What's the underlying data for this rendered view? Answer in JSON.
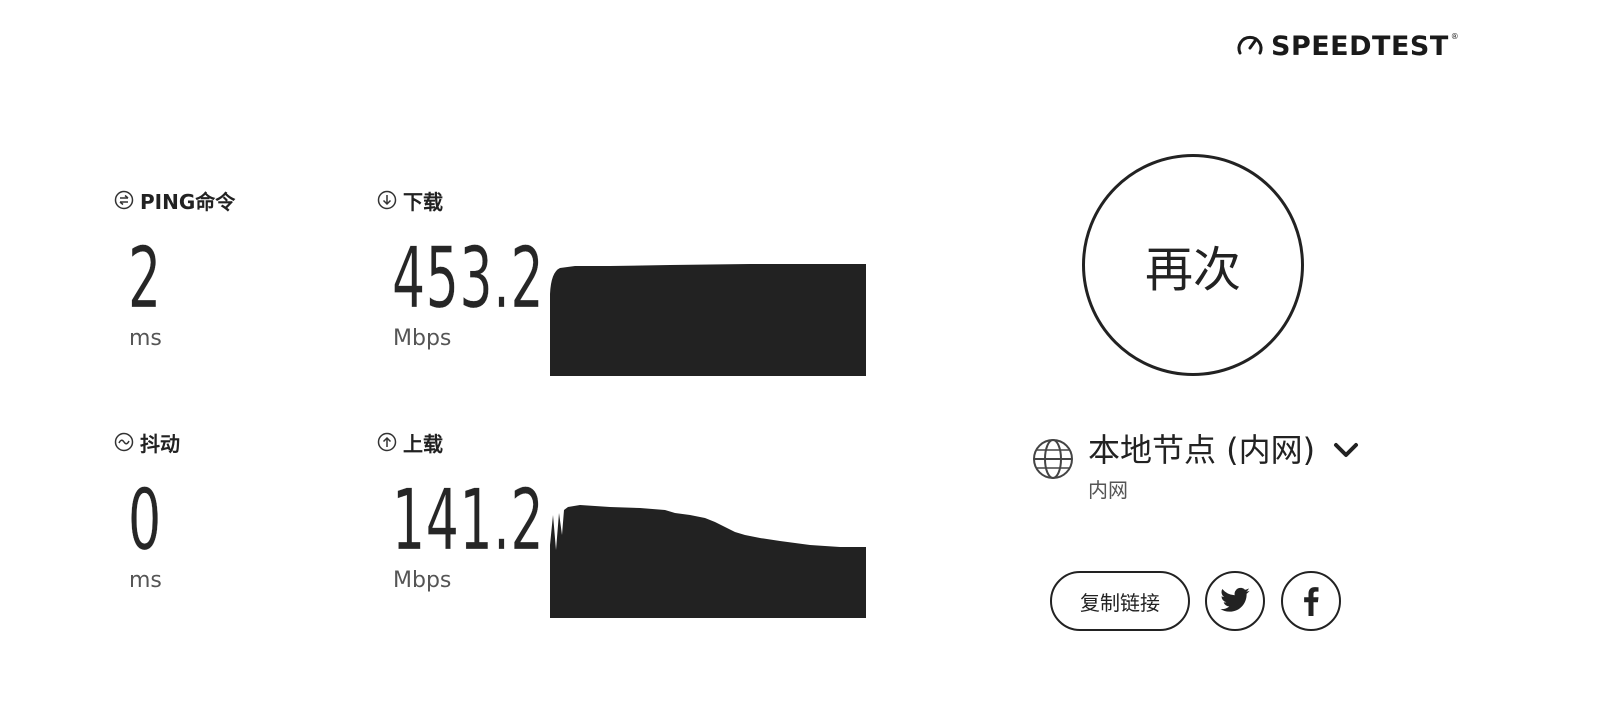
{
  "brand": {
    "name": "SPEEDTEST",
    "tm": "®"
  },
  "ping": {
    "label": "PING命令",
    "value": "2",
    "unit": "ms",
    "icon": "ping-icon"
  },
  "jitter": {
    "label": "抖动",
    "value": "0",
    "unit": "ms",
    "icon": "jitter-icon"
  },
  "download": {
    "label": "下载",
    "value": "453.2",
    "unit": "Mbps",
    "icon": "download-arrow-icon"
  },
  "upload": {
    "label": "上载",
    "value": "141.2",
    "unit": "Mbps",
    "icon": "upload-arrow-icon"
  },
  "again_button": {
    "label": "再次"
  },
  "server": {
    "name": "本地节点 (内网)",
    "sub": "内网",
    "icon": "globe-icon",
    "toggle_icon": "chevron-down-icon"
  },
  "share": {
    "copy_label": "复制链接",
    "twitter_icon": "twitter-icon",
    "facebook_icon": "facebook-icon"
  },
  "colors": {
    "text": "#222222",
    "graph_fill": "#222222",
    "background": "#ffffff"
  }
}
